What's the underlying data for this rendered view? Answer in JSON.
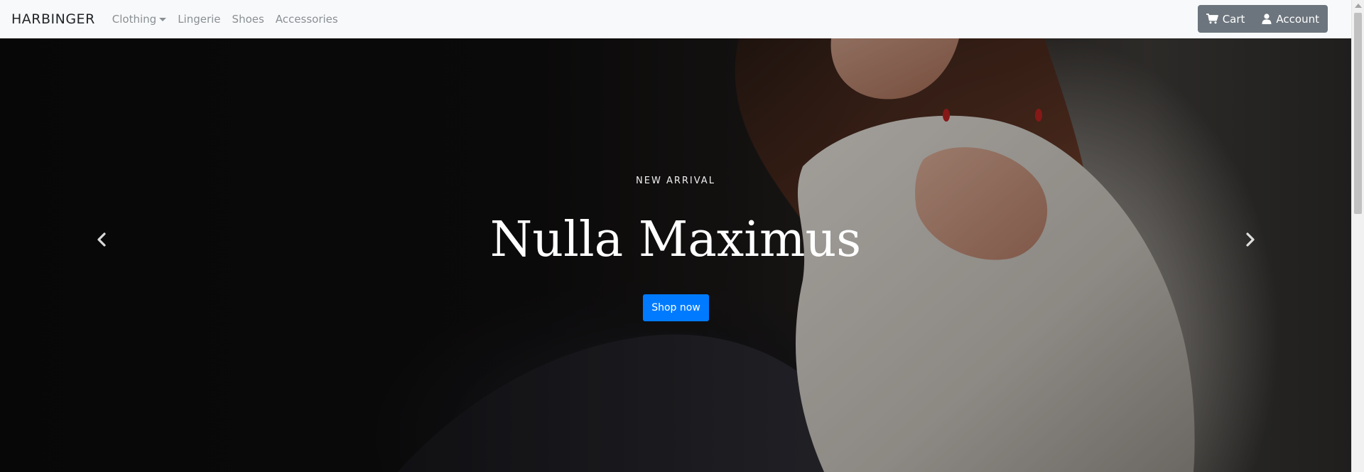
{
  "navbar": {
    "brand": "HARBINGER",
    "links": [
      {
        "label": "Clothing",
        "dropdown": true
      },
      {
        "label": "Lingerie"
      },
      {
        "label": "Shoes"
      },
      {
        "label": "Accessories"
      }
    ],
    "cart_label": "Cart",
    "account_label": "Account",
    "cart_icon": "cart-icon",
    "account_icon": "user-icon"
  },
  "hero": {
    "eyebrow": "NEW ARRIVAL",
    "title": "Nulla Maximus",
    "cta_label": "Shop now",
    "prev_icon": "chevron-left-icon",
    "next_icon": "chevron-right-icon"
  },
  "colors": {
    "navbar_bg": "#f8f9fa",
    "brand_text": "#212529",
    "nav_link": "#8a8f94",
    "nav_button_bg": "#6c757d",
    "cta_bg": "#007bff",
    "hero_text": "#ffffff"
  }
}
